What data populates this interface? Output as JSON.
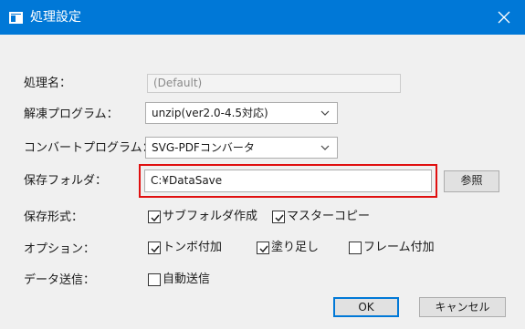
{
  "window": {
    "title": "処理設定"
  },
  "labels": {
    "process_name": "処理名：",
    "decompress_program": "解凍プログラム：",
    "convert_program": "コンバートプログラム：",
    "save_folder": "保存フォルダ：",
    "save_format": "保存形式：",
    "options": "オプション：",
    "data_send": "データ送信："
  },
  "fields": {
    "process_name_value": "(Default)",
    "decompress_selected": "unzip(ver2.0-4.5対応)",
    "convert_selected": "SVG-PDFコンバータ",
    "save_folder_value": "C:¥DataSave"
  },
  "checkboxes": {
    "subfolder": {
      "label": "サブフォルダ作成",
      "checked": true
    },
    "master_copy": {
      "label": "マスターコピー",
      "checked": true
    },
    "tonbo": {
      "label": "トンボ付加",
      "checked": true
    },
    "bleed": {
      "label": "塗り足し",
      "checked": true
    },
    "frame": {
      "label": "フレーム付加",
      "checked": false
    },
    "auto_send": {
      "label": "自動送信",
      "checked": false
    }
  },
  "buttons": {
    "browse": "参照",
    "ok": "OK",
    "cancel": "キャンセル"
  },
  "icons": {
    "close": "close-icon",
    "dropdown": "chevron-down-icon",
    "check": "checkmark-icon"
  },
  "colors": {
    "titlebar": "#0078d7",
    "highlight": "#e01010",
    "default_button_border": "#0078d7"
  }
}
